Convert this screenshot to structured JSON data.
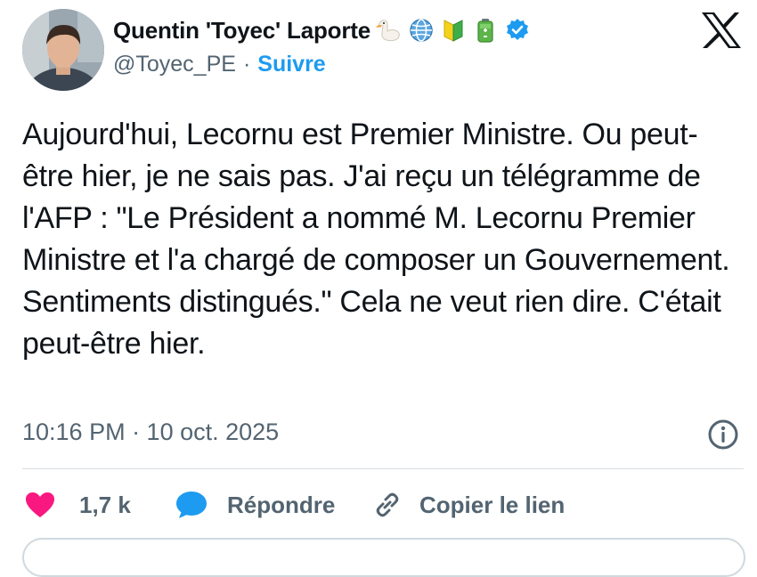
{
  "author": {
    "display_name": "Quentin 'Toyec' Laporte",
    "handle": "@Toyec_PE",
    "separator": "·",
    "follow_label": "Suivre",
    "emojis": [
      "goose-emoji",
      "globe-emoji",
      "beginner-badge-emoji",
      "battery-emoji"
    ],
    "verified": true
  },
  "tweet": {
    "text": "Aujourd'hui, Lecornu est Premier Ministre. Ou peut-être hier, je ne sais pas. J'ai reçu un télégramme de l'AFP : \"Le Président a nommé M. Lecornu Premier Ministre et l'a chargé de composer un Gouvernement. Sentiments distingués.\" Cela ne veut rien dire. C'était peut-être hier.",
    "timestamp": "10:16 PM · 10 oct. 2025"
  },
  "actions": {
    "like_count": "1,7 k",
    "reply_label": "Répondre",
    "copy_label": "Copier le lien"
  },
  "colors": {
    "accent": "#1d9bf0",
    "like": "#f91880",
    "text_secondary": "#536471",
    "text_primary": "#0f1419"
  }
}
